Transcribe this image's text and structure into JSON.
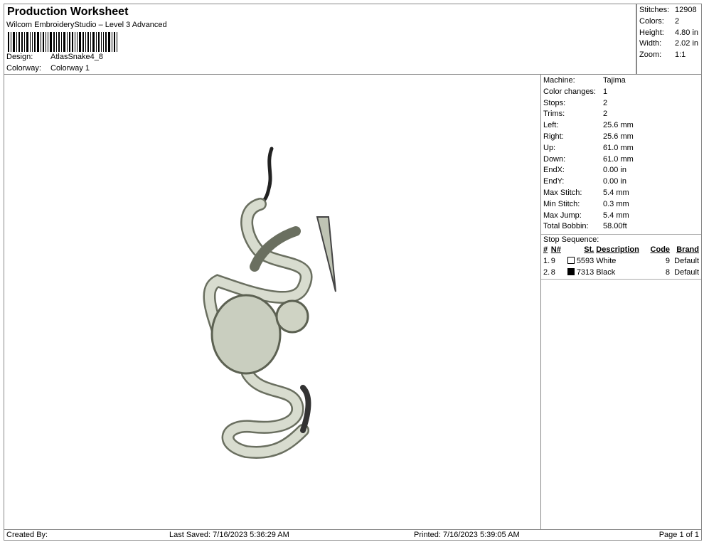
{
  "header": {
    "title": "Production Worksheet",
    "subtitle": "Wilcom EmbroideryStudio – Level 3 Advanced",
    "design_label": "Design:",
    "design_value": "AtlasSnake4_8",
    "colorway_label": "Colorway:",
    "colorway_value": "Colorway 1"
  },
  "stats": [
    {
      "k": "Stitches:",
      "v": "12908"
    },
    {
      "k": "Colors:",
      "v": "2"
    },
    {
      "k": "Height:",
      "v": "4.80 in"
    },
    {
      "k": "Width:",
      "v": "2.02 in"
    },
    {
      "k": "Zoom:",
      "v": "1:1"
    }
  ],
  "props": [
    {
      "k": "Machine:",
      "v": "Tajima"
    },
    {
      "k": "Color changes:",
      "v": "1"
    },
    {
      "k": "Stops:",
      "v": "2"
    },
    {
      "k": "Trims:",
      "v": "2"
    },
    {
      "k": "Left:",
      "v": "25.6 mm"
    },
    {
      "k": "Right:",
      "v": "25.6 mm"
    },
    {
      "k": "Up:",
      "v": "61.0 mm"
    },
    {
      "k": "Down:",
      "v": "61.0 mm"
    },
    {
      "k": "EndX:",
      "v": "0.00 in"
    },
    {
      "k": "EndY:",
      "v": "0.00 in"
    },
    {
      "k": "Max Stitch:",
      "v": "5.4 mm"
    },
    {
      "k": "Min Stitch:",
      "v": "0.3 mm"
    },
    {
      "k": "Max Jump:",
      "v": "5.4 mm"
    },
    {
      "k": "Total Bobbin:",
      "v": "58.00ft"
    }
  ],
  "stop_sequence": {
    "title": "Stop Sequence:",
    "headers": [
      "#",
      "N#",
      "St.",
      "Description",
      "Code",
      "Brand"
    ],
    "rows": [
      {
        "num": "1.",
        "n": "9",
        "color": "#ffffff",
        "st": "5593",
        "desc": "White",
        "code": "9",
        "brand": "Default"
      },
      {
        "num": "2.",
        "n": "8",
        "color": "#000000",
        "st": "7313",
        "desc": "Black",
        "code": "8",
        "brand": "Default"
      }
    ]
  },
  "footer": {
    "created": "Created By:",
    "saved": "Last Saved: 7/16/2023 5:36:29 AM",
    "printed": "Printed: 7/16/2023 5:39:05 AM",
    "page": "Page 1 of 1"
  }
}
